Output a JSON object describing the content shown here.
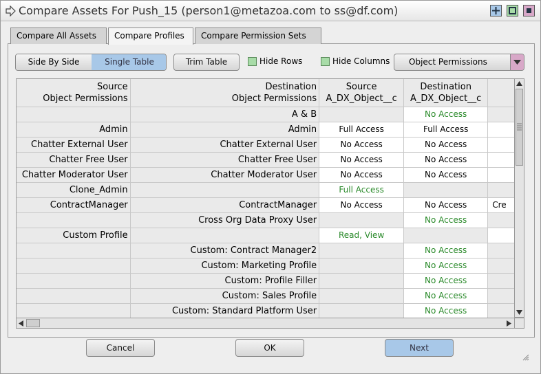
{
  "window": {
    "title": "Compare Assets For Push_15 (person1@metazoa.com to ss@df.com)"
  },
  "tabs": [
    "Compare All Assets",
    "Compare Profiles",
    "Compare Permission Sets"
  ],
  "toolbar": {
    "side_by_side": "Side By Side",
    "single_table": "Single Table",
    "trim_table": "Trim Table",
    "hide_rows": "Hide Rows",
    "hide_columns": "Hide Columns",
    "category": "Object Permissions"
  },
  "grid": {
    "header": [
      [
        "Source",
        "Object Permissions"
      ],
      [
        "Destination",
        "Object Permissions"
      ],
      [
        "Source",
        "A_DX_Object__c"
      ],
      [
        "Destination",
        "A_DX_Object__c"
      ],
      [
        "",
        ""
      ]
    ],
    "rows": [
      {
        "src": "",
        "dst": "A & B",
        "c1": "",
        "c2": "No Access",
        "c3": ""
      },
      {
        "src": "Admin",
        "dst": "Admin",
        "c1": "Full Access",
        "c2": "Full Access",
        "c3": ""
      },
      {
        "src": "Chatter External User",
        "dst": "Chatter External User",
        "c1": "No Access",
        "c2": "No Access",
        "c3": ""
      },
      {
        "src": "Chatter Free User",
        "dst": "Chatter Free User",
        "c1": "No Access",
        "c2": "No Access",
        "c3": ""
      },
      {
        "src": "Chatter Moderator User",
        "dst": "Chatter Moderator User",
        "c1": "No Access",
        "c2": "No Access",
        "c3": ""
      },
      {
        "src": "Clone_Admin",
        "dst": "",
        "c1": "Full Access",
        "c2": "",
        "c3": ""
      },
      {
        "src": "ContractManager",
        "dst": "ContractManager",
        "c1": "No Access",
        "c2": "No Access",
        "c3": "Cre"
      },
      {
        "src": "",
        "dst": "Cross Org Data Proxy User",
        "c1": "",
        "c2": "No Access",
        "c3": ""
      },
      {
        "src": "Custom Profile",
        "dst": "",
        "c1": "Read, View",
        "c2": "",
        "c3": ""
      },
      {
        "src": "",
        "dst": "Custom: Contract Manager2",
        "c1": "",
        "c2": "No Access",
        "c3": ""
      },
      {
        "src": "",
        "dst": "Custom: Marketing Profile",
        "c1": "",
        "c2": "No Access",
        "c3": ""
      },
      {
        "src": "",
        "dst": "Custom: Profile Filler",
        "c1": "",
        "c2": "No Access",
        "c3": ""
      },
      {
        "src": "",
        "dst": "Custom: Sales Profile",
        "c1": "",
        "c2": "No Access",
        "c3": ""
      },
      {
        "src": "",
        "dst": "Custom: Standard Platform User",
        "c1": "",
        "c2": "No Access",
        "c3": ""
      }
    ]
  },
  "buttons": {
    "cancel": "Cancel",
    "ok": "OK",
    "next": "Next"
  },
  "colors": {
    "accent": "#a8c8e8",
    "green_text": "#2a8a2a",
    "dropdown_arrow": "#d8a8c8"
  }
}
